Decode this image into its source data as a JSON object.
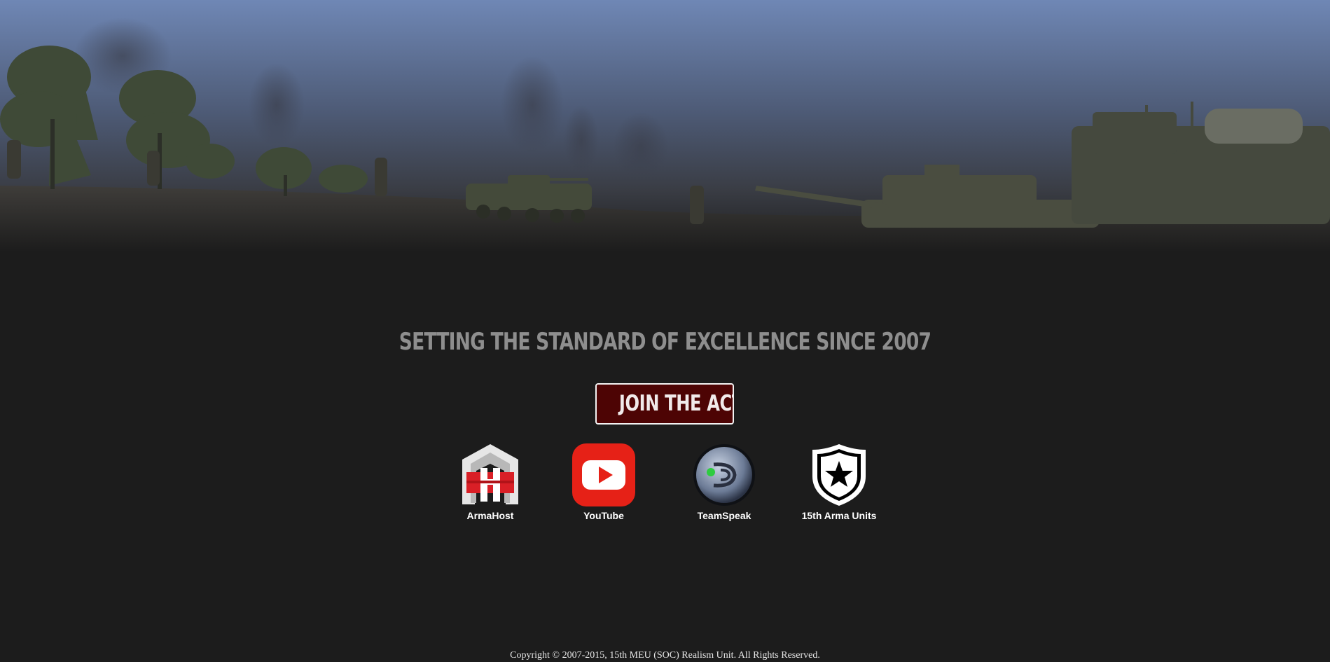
{
  "hero": {
    "scene": "military-battlefield-banner"
  },
  "tagline": "SETTING THE STANDARD OF EXCELLENCE SINCE 2007",
  "join_button": {
    "label": "JOIN THE ACTION"
  },
  "links": [
    {
      "label": "ArmaHost",
      "icon": "armahost-logo-icon"
    },
    {
      "label": "YouTube",
      "icon": "youtube-play-icon"
    },
    {
      "label": "TeamSpeak",
      "icon": "teamspeak-logo-icon"
    },
    {
      "label": "15th Arma Units",
      "icon": "shield-star-icon"
    }
  ],
  "footer": {
    "copyright": "Copyright © 2007-2015, 15th MEU (SOC) Realism Unit. All Rights Reserved."
  },
  "colors": {
    "background": "#1c1c1c",
    "button_bg": "#4d0404",
    "youtube_red": "#e62117",
    "tagline": "#8e8e8e"
  }
}
